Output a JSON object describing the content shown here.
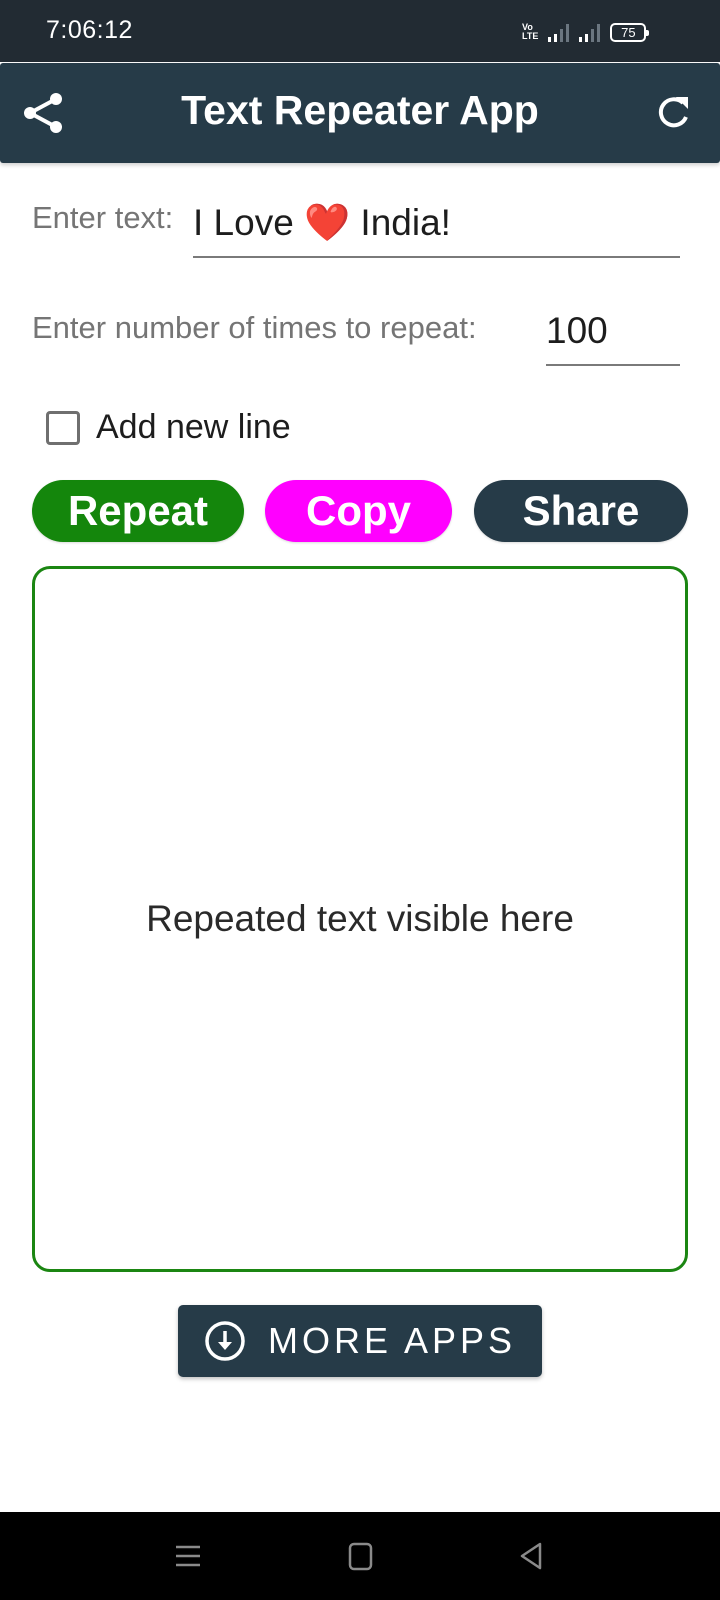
{
  "status_bar": {
    "time": "7:06:12",
    "network_label_top": "Vo",
    "network_label_bottom": "LTE",
    "battery_level": "75"
  },
  "app_bar": {
    "title": "Text Repeater App",
    "left_icon": "share-icon",
    "right_icon": "refresh-icon",
    "background_color": "#263b48"
  },
  "form": {
    "text_label": "Enter text:",
    "text_value": "I Love ❤️ India!",
    "repeat_label": "Enter number of times to repeat:",
    "repeat_value": "100",
    "new_line_checkbox": {
      "label": "Add new line",
      "checked": false
    }
  },
  "buttons": {
    "repeat": {
      "label": "Repeat",
      "color": "#14860c"
    },
    "copy": {
      "label": "Copy",
      "color": "#ff00ff"
    },
    "share": {
      "label": "Share",
      "color": "#263b48"
    }
  },
  "output": {
    "placeholder": "Repeated text visible here",
    "border_color": "#1b8612"
  },
  "more_apps": {
    "label": "MORE APPS",
    "icon": "download-circle-icon"
  },
  "nav_bar": {
    "buttons": [
      "menu-icon",
      "home-icon",
      "back-icon"
    ]
  }
}
